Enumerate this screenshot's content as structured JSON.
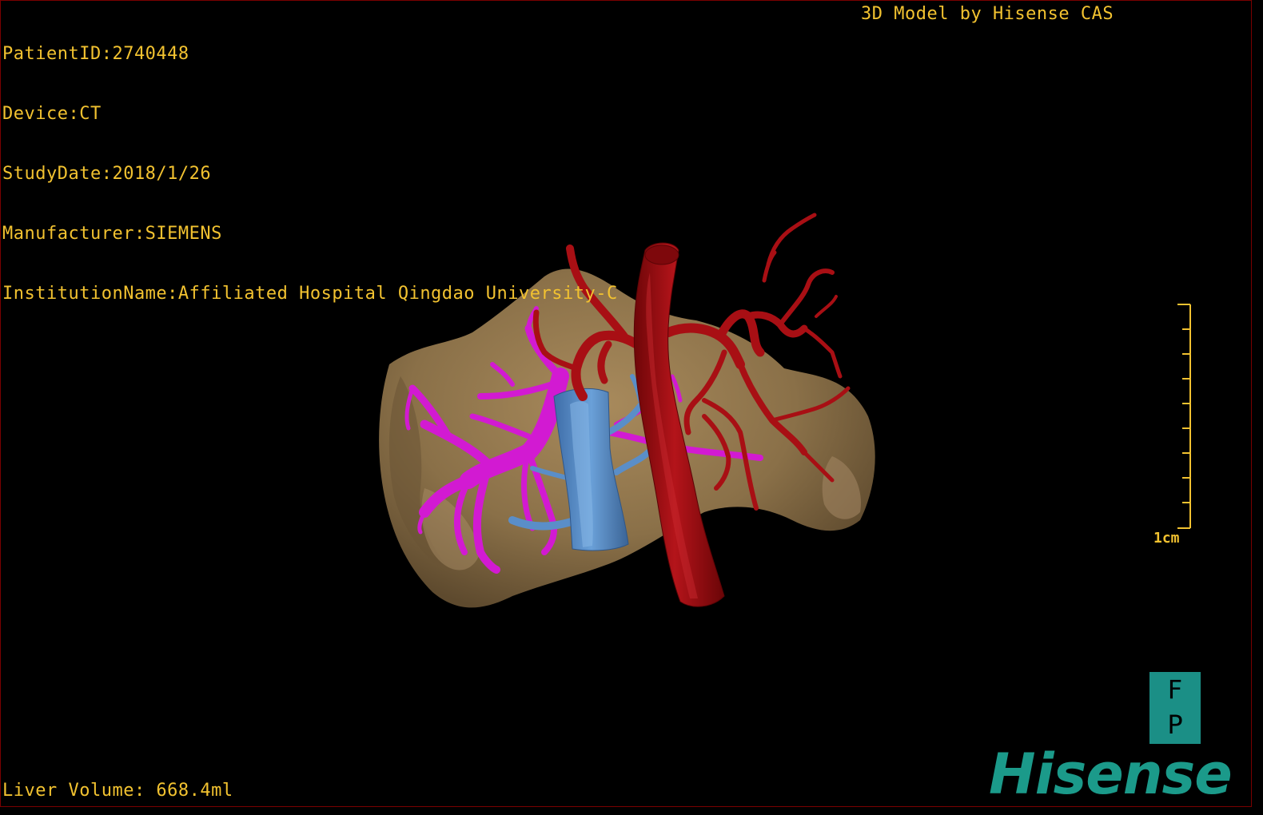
{
  "header": {
    "patient_id": "PatientID:2740448",
    "device": "Device:CT",
    "study_date": "StudyDate:2018/1/26",
    "manufacturer": "Manufacturer:SIEMENS",
    "institution": "InstitutionName:Affiliated Hospital Qingdao University-C"
  },
  "brand_caption": "3D Model by Hisense CAS",
  "footer": {
    "liver_volume": "Liver Volume: 668.4ml"
  },
  "scale": {
    "label": "1cm"
  },
  "orientation": {
    "top": "F",
    "bottom": "P"
  },
  "logo": {
    "text": "Hisense"
  },
  "colors": {
    "liver": "#8a7048",
    "portal_vein": "#d21ad2",
    "hepatic_vein": "#5a8ec8",
    "artery": "#a80f14",
    "overlay_text": "#f2c230",
    "brand": "#1b9a8a"
  },
  "icons": [
    "orientation-cube-icon",
    "hisense-logo-icon"
  ]
}
